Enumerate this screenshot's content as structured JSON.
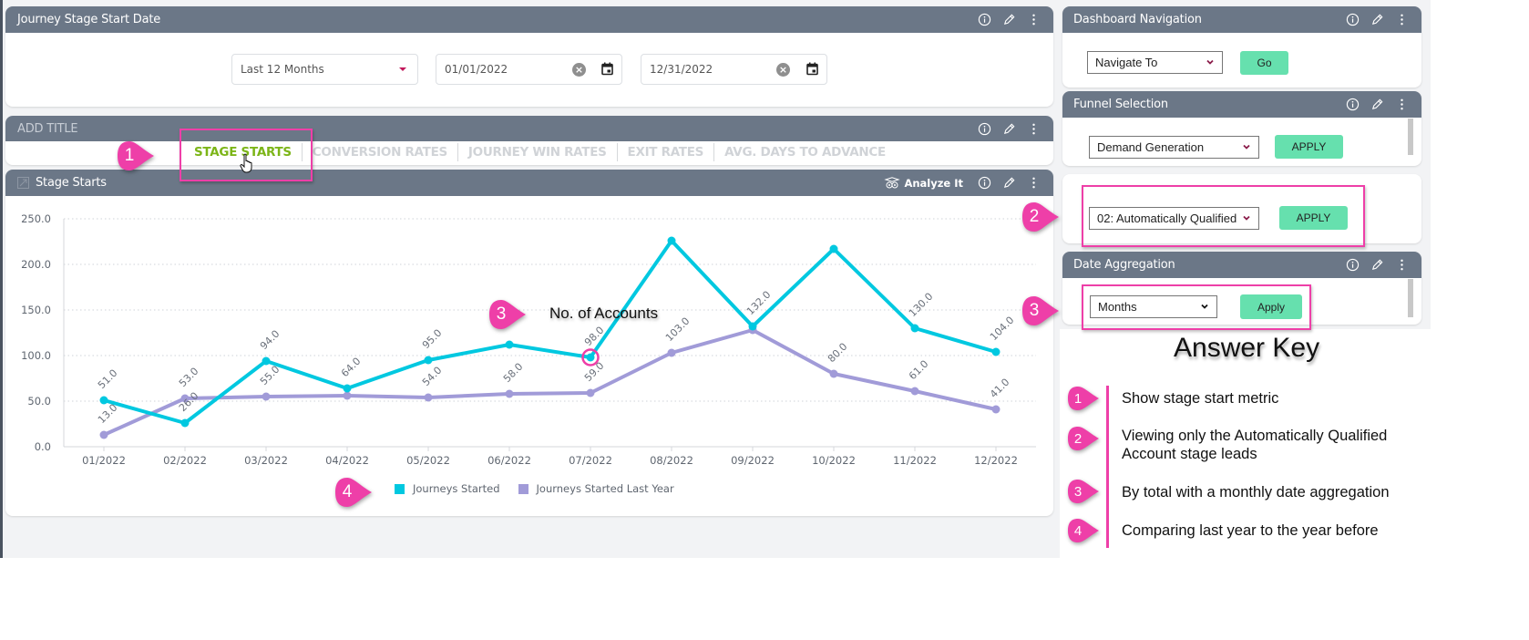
{
  "journey_stage_panel": {
    "title": "Journey Stage Start Date",
    "range_select": "Last 12 Months",
    "start_date": "01/01/2022",
    "end_date": "12/31/2022"
  },
  "tabs_panel": {
    "title": "ADD TITLE",
    "tabs": [
      {
        "label": "STAGE STARTS",
        "active": true
      },
      {
        "label": "CONVERSION RATES",
        "active": false
      },
      {
        "label": "JOURNEY WIN RATES",
        "active": false
      },
      {
        "label": "EXIT RATES",
        "active": false
      },
      {
        "label": "AVG. DAYS TO ADVANCE",
        "active": false
      }
    ]
  },
  "chart_panel": {
    "title": "Stage Starts",
    "analyze_label": "Analyze It"
  },
  "dashboard_nav": {
    "title": "Dashboard Navigation",
    "select_value": "Navigate To",
    "go_label": "Go"
  },
  "funnel_selection": {
    "title": "Funnel Selection",
    "select_value": "Demand Generation",
    "apply_label": "APPLY"
  },
  "stage_filter": {
    "select_value": "02: Automatically Qualified",
    "apply_label": "APPLY"
  },
  "date_aggregation": {
    "title": "Date Aggregation",
    "select_value": "Months",
    "apply_label": "Apply"
  },
  "annotations": {
    "pins": [
      "1",
      "2",
      "3",
      "3",
      "4"
    ],
    "chart_callout": "No. of Accounts",
    "answer_key": {
      "title": "Answer Key",
      "items": [
        {
          "num": "1",
          "text": "Show stage start metric"
        },
        {
          "num": "2",
          "text": "Viewing only the Automatically Qualified Account stage leads"
        },
        {
          "num": "3",
          "text": "By total with a monthly date aggregation"
        },
        {
          "num": "4",
          "text": "Comparing last year to the year before"
        }
      ]
    },
    "accent_color": "#ee3fa8"
  },
  "chart_data": {
    "type": "line",
    "title": "Stage Starts",
    "xlabel": "",
    "ylabel": "",
    "ylim": [
      0,
      250
    ],
    "yticks": [
      "0.0",
      "50.0",
      "100.0",
      "150.0",
      "200.0",
      "250.0"
    ],
    "ytick_values": [
      0,
      50,
      100,
      150,
      200,
      250
    ],
    "grid": true,
    "legend_position": "bottom",
    "categories": [
      "01/2022",
      "02/2022",
      "03/2022",
      "04/2022",
      "05/2022",
      "06/2022",
      "07/2022",
      "08/2022",
      "09/2022",
      "10/2022",
      "11/2022",
      "12/2022"
    ],
    "series": [
      {
        "name": "Journeys Started",
        "color": "#00c8e0",
        "values": [
          51,
          26,
          94,
          64,
          95,
          112,
          98,
          226,
          132,
          217,
          130,
          104
        ],
        "labels": [
          "51.0",
          "26.0",
          "94.0",
          "64.0",
          "95.0",
          "",
          "98.0",
          "",
          "132.0",
          "",
          "130.0",
          "104.0"
        ]
      },
      {
        "name": "Journeys Started Last Year",
        "color": "#a19bd8",
        "values": [
          13,
          53,
          55,
          56,
          54,
          58,
          59,
          103,
          128,
          80,
          61,
          41
        ],
        "labels": [
          "13.0",
          "53.0",
          "55.0",
          "",
          "54.0",
          "58.0",
          "59.0",
          "103.0",
          "",
          "80.0",
          "61.0",
          "41.0"
        ]
      }
    ],
    "highlighted_point": {
      "series": "Journeys Started",
      "category": "07/2022"
    }
  }
}
